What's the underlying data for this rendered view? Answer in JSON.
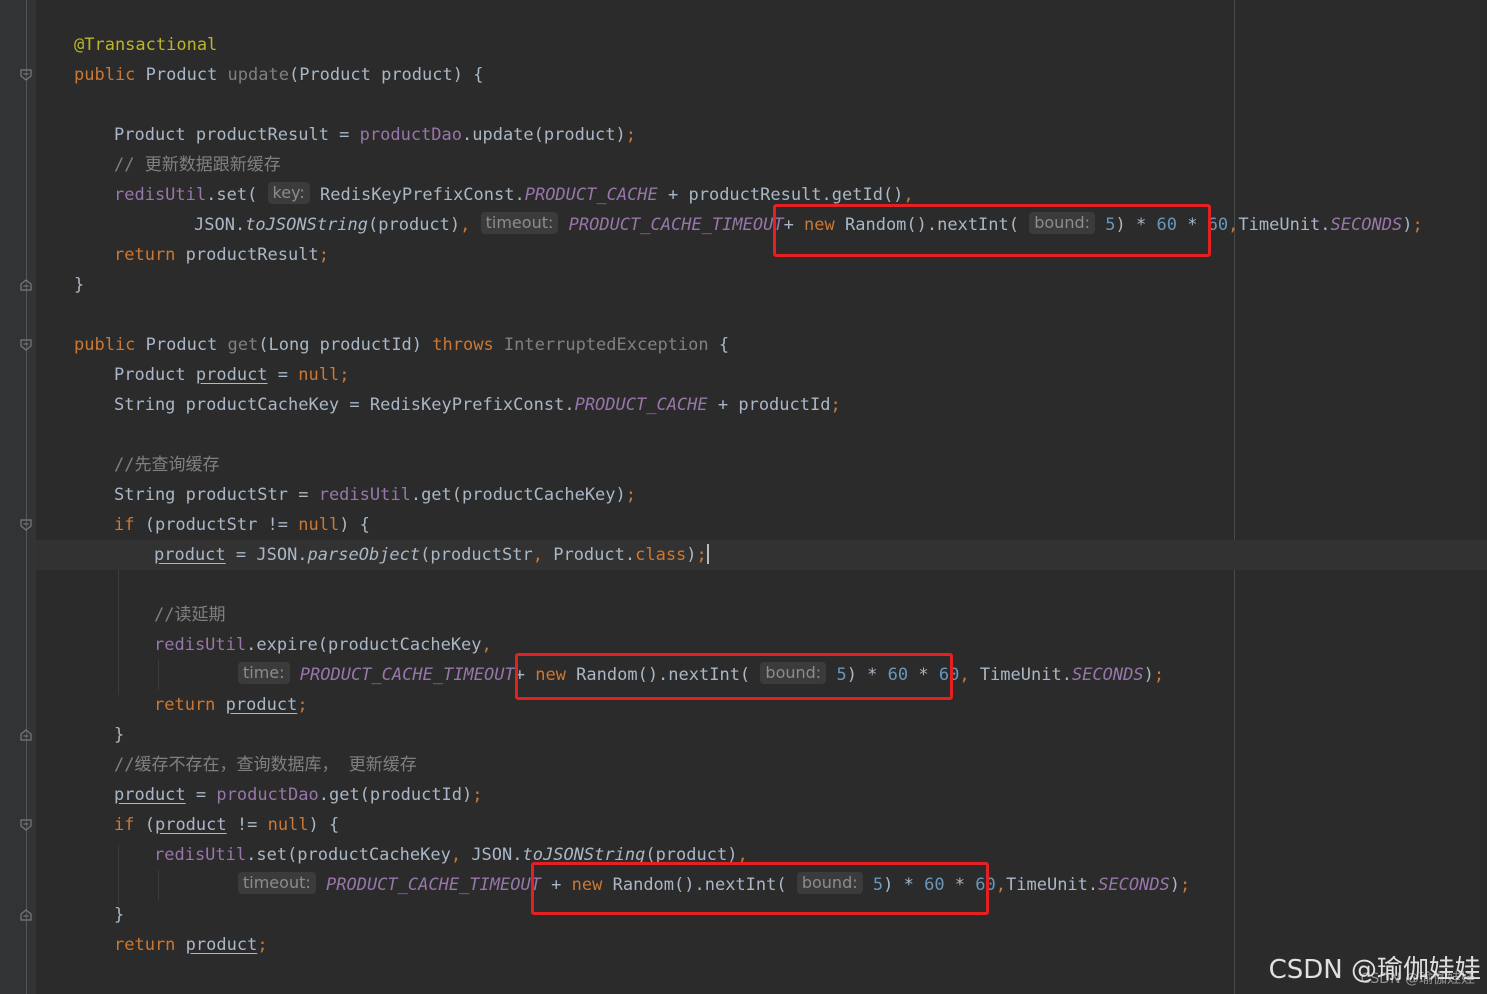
{
  "editor": {
    "lines": [
      {
        "id": "L1",
        "segments": [
          [
            "ann",
            "@Transactional"
          ]
        ]
      },
      {
        "id": "L2",
        "segments": [
          [
            "kw",
            "public "
          ],
          [
            "",
            "Product "
          ],
          [
            "gray",
            "update"
          ],
          [
            "",
            "(Product product) {"
          ]
        ]
      },
      {
        "id": "L3",
        "segments": []
      },
      {
        "id": "L4",
        "segments": [
          [
            "",
            "Product productResult = "
          ],
          [
            "fld",
            "productDao"
          ],
          [
            "",
            ".update(product)"
          ],
          [
            "kw",
            ";"
          ]
        ]
      },
      {
        "id": "L5",
        "segments": [
          [
            "cmt",
            "// 更新数据跟新缓存"
          ]
        ]
      },
      {
        "id": "L6",
        "segments": [
          [
            "fld",
            "redisUtil"
          ],
          [
            "",
            ".set( "
          ],
          [
            "hint",
            "key:"
          ],
          [
            "",
            " RedisKeyPrefixConst."
          ],
          [
            "cst",
            "PRODUCT_CACHE"
          ],
          [
            "",
            " + productResult.getId()"
          ],
          [
            "kw",
            ","
          ]
        ]
      },
      {
        "id": "L7",
        "segments": [
          [
            "",
            "JSON."
          ],
          [
            "ital",
            "toJSONString"
          ],
          [
            "",
            "(product)"
          ],
          [
            "kw",
            ", "
          ],
          [
            "hint",
            "timeout:"
          ],
          [
            "",
            " "
          ],
          [
            "cst",
            "PRODUCT_CACHE_TIMEOUT"
          ],
          [
            "",
            "+ "
          ],
          [
            "kw",
            "new "
          ],
          [
            "",
            "Random().nextInt( "
          ],
          [
            "hint",
            "bound:"
          ],
          [
            "",
            " "
          ],
          [
            "num",
            "5"
          ],
          [
            "",
            ") * "
          ],
          [
            "num",
            "60"
          ],
          [
            "",
            " * "
          ],
          [
            "num",
            "60"
          ],
          [
            "kw",
            ","
          ],
          [
            "",
            "TimeUnit."
          ],
          [
            "cst",
            "SECONDS"
          ],
          [
            "",
            ")"
          ],
          [
            "kw",
            ";"
          ]
        ]
      },
      {
        "id": "L8",
        "segments": [
          [
            "kw",
            "return "
          ],
          [
            "",
            "productResult"
          ],
          [
            "kw",
            ";"
          ]
        ]
      },
      {
        "id": "L9",
        "segments": [
          [
            "",
            "}"
          ]
        ]
      },
      {
        "id": "L10",
        "segments": []
      },
      {
        "id": "L11",
        "segments": [
          [
            "kw",
            "public "
          ],
          [
            "",
            "Product "
          ],
          [
            "gray",
            "get"
          ],
          [
            "",
            "(Long productId) "
          ],
          [
            "kw",
            "throws "
          ],
          [
            "gray",
            "InterruptedException"
          ],
          [
            "",
            " {"
          ]
        ]
      },
      {
        "id": "L12",
        "segments": [
          [
            "",
            "Product "
          ],
          [
            "ul",
            "product"
          ],
          [
            "",
            " = "
          ],
          [
            "kw",
            "null;"
          ]
        ]
      },
      {
        "id": "L13",
        "segments": [
          [
            "",
            "String productCacheKey = RedisKeyPrefixConst."
          ],
          [
            "cst",
            "PRODUCT_CACHE"
          ],
          [
            "",
            " + productId"
          ],
          [
            "kw",
            ";"
          ]
        ]
      },
      {
        "id": "L14",
        "segments": []
      },
      {
        "id": "L15",
        "segments": [
          [
            "cmt",
            "//先查询缓存"
          ]
        ]
      },
      {
        "id": "L16",
        "segments": [
          [
            "",
            "String productStr = "
          ],
          [
            "fld",
            "redisUtil"
          ],
          [
            "",
            ".get(productCacheKey)"
          ],
          [
            "kw",
            ";"
          ]
        ]
      },
      {
        "id": "L17",
        "segments": [
          [
            "kw",
            "if "
          ],
          [
            "",
            "(productStr != "
          ],
          [
            "kw",
            "null"
          ],
          [
            "",
            ") {"
          ]
        ]
      },
      {
        "id": "L18",
        "segments": [
          [
            "ul",
            "product"
          ],
          [
            "",
            " = JSON."
          ],
          [
            "ital",
            "parseObject"
          ],
          [
            "",
            "(productStr"
          ],
          [
            "kw",
            ", "
          ],
          [
            "",
            "Product."
          ],
          [
            "kw",
            "class"
          ],
          [
            "",
            ")"
          ],
          [
            "kw",
            ";"
          ],
          [
            "caret",
            ""
          ]
        ]
      },
      {
        "id": "L19",
        "segments": []
      },
      {
        "id": "L20",
        "segments": [
          [
            "cmt",
            "//读延期"
          ]
        ]
      },
      {
        "id": "L21",
        "segments": [
          [
            "fld",
            "redisUtil"
          ],
          [
            "",
            ".expire(productCacheKey"
          ],
          [
            "kw",
            ","
          ]
        ]
      },
      {
        "id": "L22",
        "segments": [
          [
            "hint",
            "time:"
          ],
          [
            "",
            " "
          ],
          [
            "cst",
            "PRODUCT_CACHE_TIMEOUT"
          ],
          [
            "",
            "+ "
          ],
          [
            "kw",
            "new "
          ],
          [
            "",
            "Random().nextInt( "
          ],
          [
            "hint",
            "bound:"
          ],
          [
            "",
            " "
          ],
          [
            "num",
            "5"
          ],
          [
            "",
            ") * "
          ],
          [
            "num",
            "60"
          ],
          [
            "",
            " * "
          ],
          [
            "num",
            "60"
          ],
          [
            "kw",
            ", "
          ],
          [
            "",
            "TimeUnit."
          ],
          [
            "cst",
            "SECONDS"
          ],
          [
            "",
            ")"
          ],
          [
            "kw",
            ";"
          ]
        ]
      },
      {
        "id": "L23",
        "segments": [
          [
            "kw",
            "return "
          ],
          [
            "ul",
            "product"
          ],
          [
            "kw",
            ";"
          ]
        ]
      },
      {
        "id": "L24",
        "segments": [
          [
            "",
            "}"
          ]
        ]
      },
      {
        "id": "L25",
        "segments": [
          [
            "cmt",
            "//缓存不存在，查询数据库， 更新缓存"
          ]
        ]
      },
      {
        "id": "L26",
        "segments": [
          [
            "ul",
            "product"
          ],
          [
            "",
            " = "
          ],
          [
            "fld",
            "productDao"
          ],
          [
            "",
            ".get(productId)"
          ],
          [
            "kw",
            ";"
          ]
        ]
      },
      {
        "id": "L27",
        "segments": [
          [
            "kw",
            "if "
          ],
          [
            "",
            "("
          ],
          [
            "ul",
            "product"
          ],
          [
            "",
            " != "
          ],
          [
            "kw",
            "null"
          ],
          [
            "",
            ") {"
          ]
        ]
      },
      {
        "id": "L28",
        "segments": [
          [
            "fld",
            "redisUtil"
          ],
          [
            "",
            ".set(productCacheKey"
          ],
          [
            "kw",
            ", "
          ],
          [
            "",
            "JSON."
          ],
          [
            "ital",
            "toJSONString"
          ],
          [
            "",
            "(product)"
          ],
          [
            "kw",
            ","
          ]
        ]
      },
      {
        "id": "L29",
        "segments": [
          [
            "hint",
            "timeout:"
          ],
          [
            "",
            " "
          ],
          [
            "cst",
            "PRODUCT_CACHE_TIMEOUT"
          ],
          [
            "",
            " + "
          ],
          [
            "kw",
            "new "
          ],
          [
            "",
            "Random().nextInt( "
          ],
          [
            "hint",
            "bound:"
          ],
          [
            "",
            " "
          ],
          [
            "num",
            "5"
          ],
          [
            "",
            ") * "
          ],
          [
            "num",
            "60"
          ],
          [
            "",
            " * "
          ],
          [
            "num",
            "60"
          ],
          [
            "kw",
            ","
          ],
          [
            "",
            "TimeUnit."
          ],
          [
            "cst",
            "SECONDS"
          ],
          [
            "",
            ")"
          ],
          [
            "kw",
            ";"
          ]
        ]
      },
      {
        "id": "L30",
        "segments": [
          [
            "",
            "}"
          ]
        ]
      },
      {
        "id": "L31",
        "segments": [
          [
            "kw",
            "return "
          ],
          [
            "ul",
            "product"
          ],
          [
            "kw",
            ";"
          ]
        ]
      }
    ]
  },
  "watermark": {
    "text": "CSDN @瑜伽娃娃",
    "sub_text": "CSDN @瑜伽娃娃"
  },
  "colors": {
    "background": "#2b2b2b",
    "keyword": "#cc7832",
    "annotation": "#bbb529",
    "field": "#9876aa",
    "number": "#6897bb",
    "comment": "#808080",
    "highlight_box": "#e52020"
  }
}
